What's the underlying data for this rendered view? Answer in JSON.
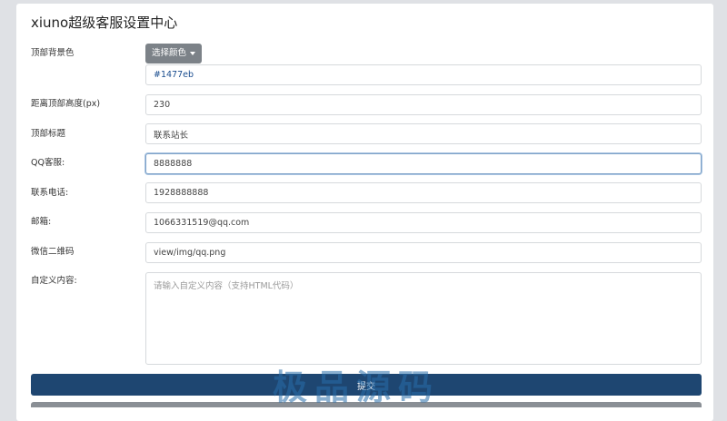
{
  "page": {
    "title": "xiuno超级客服设置中心"
  },
  "form": {
    "header_bg": {
      "label": "顶部背景色",
      "button_label": "选择颜色",
      "value": "#1477eb"
    },
    "top_height": {
      "label": "距离顶部高度(px)",
      "value": "230"
    },
    "header_title": {
      "label": "顶部标题",
      "value": "联系站长"
    },
    "qq": {
      "label": "QQ客服:",
      "value": "8888888"
    },
    "phone": {
      "label": "联系电话:",
      "value": "1928888888"
    },
    "email": {
      "label": "邮箱:",
      "value": "1066331519@qq.com"
    },
    "wechat_qr": {
      "label": "微信二维码",
      "value": "view/img/qq.png"
    },
    "custom_content": {
      "label": "自定义内容:",
      "placeholder": "请输入自定义内容（支持HTML代码）",
      "value": ""
    },
    "submit_label": "提交"
  },
  "watermark": {
    "text": "极品源码"
  },
  "colors": {
    "accent": "#1e4671",
    "color_button": "#7c8288",
    "background": "#dfe1e5",
    "color_value": "#1477eb"
  }
}
